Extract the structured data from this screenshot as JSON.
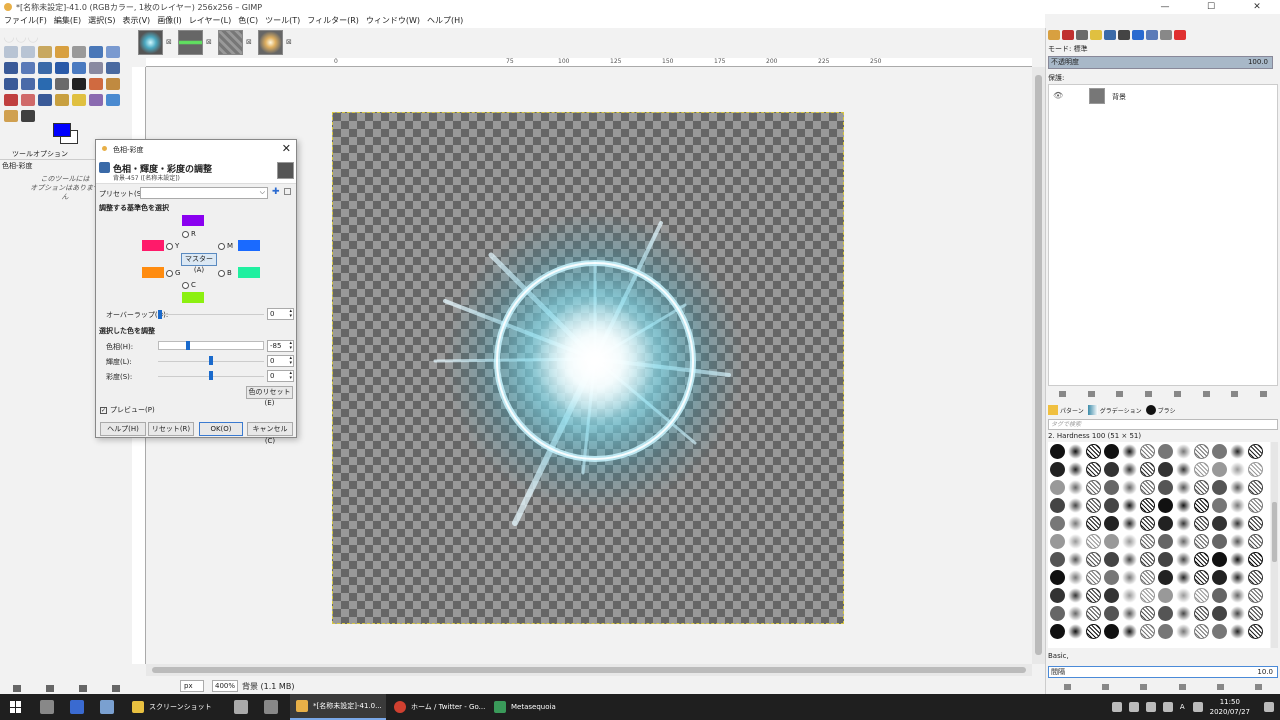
{
  "window": {
    "title": "*[名称未設定]-41.0 (RGBカラー, 1枚のレイヤー) 256x256 – GIMP",
    "minimize": "—",
    "maximize": "☐",
    "close": "✕"
  },
  "menu": [
    "ファイル(F)",
    "編集(E)",
    "選択(S)",
    "表示(V)",
    "画像(I)",
    "レイヤー(L)",
    "色(C)",
    "ツール(T)",
    "フィルター(R)",
    "ウィンドウ(W)",
    "ヘルプ(H)"
  ],
  "toolbox": {
    "fg_color": "#0000ff",
    "bg_color": "#ffffff",
    "tool_options_tab": "ツールオプション",
    "tool_options_title": "色相-彩度",
    "tool_options_msg_line1": "このツールには",
    "tool_options_msg_line2": "オプションはありません"
  },
  "ruler_marks": [
    "75",
    "100",
    "125",
    "150",
    "175",
    "200",
    "225",
    "250"
  ],
  "ruler_zero": "0",
  "status": {
    "unit": "px",
    "zoom": "400%",
    "layer_info": "背景 (1.1 MB)"
  },
  "right_panel": {
    "mode_label": "モード: 標準",
    "opacity_label": "不透明度",
    "opacity_value": "100.0",
    "lock_label": "保護:",
    "layer_name": "背景",
    "brush_tabs": [
      "パターン",
      "グラデーション",
      "ブラシ"
    ],
    "tag_filter_placeholder": "タグで検索",
    "brush_name": "2. Hardness 100 (51 × 51)",
    "brush_group": "Basic,",
    "spacing_label": "間隔",
    "spacing_value": "10.0"
  },
  "dialog": {
    "title": "色相-彩度",
    "close": "✕",
    "heading": "色相・輝度・彩度の調整",
    "subheading": "背景-457 ([名称未設定])",
    "preset_label": "プリセット(S):",
    "preset_value": "",
    "section_primary": "調整する基準色を選択",
    "radio_r": "R",
    "radio_y": "Y",
    "radio_m": "M",
    "radio_g": "G",
    "radio_b": "B",
    "radio_c": "C",
    "master": "マスター(A)",
    "overlap_label": "オーバーラップ(O):",
    "overlap_value": "0",
    "section_adjust": "選択した色を調整",
    "hue_label": "色相(H):",
    "hue_value": "-85",
    "lightness_label": "輝度(L):",
    "lightness_value": "0",
    "saturation_label": "彩度(S):",
    "saturation_value": "0",
    "color_reset": "色のリセット(E)",
    "preview_label": "プレビュー(P)",
    "btn_help": "ヘルプ(H)",
    "btn_reset": "リセット(R)",
    "btn_ok": "OK(O)",
    "btn_cancel": "キャンセル(C)",
    "chip_colors": {
      "r": "#8a00f0",
      "y": "#ff1a6a",
      "m": "#1a6aff",
      "g": "#ff8c10",
      "b": "#20f0a0",
      "c": "#8cf010"
    }
  },
  "taskbar": {
    "items": [
      "スクリーンショット",
      "*[名称未設定]-41.0...",
      "ホーム / Twitter - Go...",
      "Metasequoia"
    ],
    "time": "11:50",
    "date": "2020/07/27",
    "ime": "A"
  }
}
